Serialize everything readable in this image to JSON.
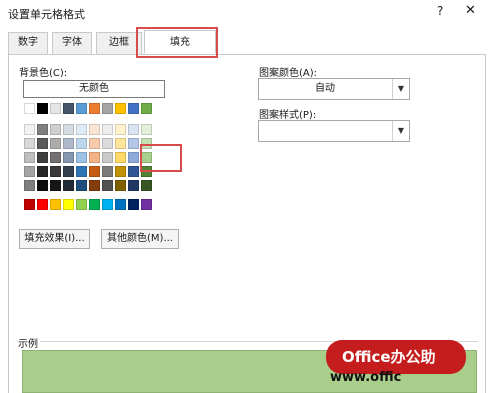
{
  "dialog": {
    "title": "设置单元格格式",
    "help_glyph": "?",
    "close_glyph": "✕"
  },
  "tabs": [
    {
      "label": "数字"
    },
    {
      "label": "字体"
    },
    {
      "label": "边框"
    },
    {
      "label": "填充",
      "active": true
    }
  ],
  "fill": {
    "background_color_label": "背景色(C):",
    "no_color_button": "无颜色",
    "fill_effects_button": "填充效果(I)...",
    "more_colors_button": "其他颜色(M)...",
    "pattern_color_label": "图案颜色(A):",
    "pattern_color_value": "自动",
    "pattern_style_label": "图案样式(P):",
    "pattern_style_value": "",
    "sample_label": "示例",
    "sample_color": "#a9cd8b"
  },
  "palette": {
    "theme_top": [
      "#ffffff",
      "#000000",
      "#e7e6e6",
      "#44546a",
      "#5b9bd5",
      "#ed7d31",
      "#a5a5a5",
      "#ffc000",
      "#4472c4",
      "#70ad47"
    ],
    "tints": [
      [
        "#f2f2f2",
        "#7f7f7f",
        "#d0cece",
        "#d6dce4",
        "#deebf6",
        "#fbe5d5",
        "#ededed",
        "#fff2cc",
        "#dae3f3",
        "#e2efd9"
      ],
      [
        "#d8d8d8",
        "#595959",
        "#aeabab",
        "#adb9ca",
        "#bdd7ee",
        "#f7cbac",
        "#dbdbdb",
        "#fee599",
        "#b4c6e7",
        "#c5e0b3"
      ],
      [
        "#bfbfbf",
        "#3f3f3f",
        "#757070",
        "#8496b0",
        "#9cc3e5",
        "#f4b183",
        "#c9c9c9",
        "#ffd965",
        "#8eaadb",
        "#a8d08d"
      ],
      [
        "#a5a5a5",
        "#262626",
        "#3a3838",
        "#323f4f",
        "#2e75b5",
        "#c55a11",
        "#7b7b7b",
        "#bf9000",
        "#2f5496",
        "#538135"
      ],
      [
        "#7f7f7f",
        "#0c0c0c",
        "#171616",
        "#222a35",
        "#1e4e79",
        "#833c0b",
        "#525252",
        "#7f6000",
        "#1f3864",
        "#375623"
      ]
    ],
    "standard": [
      "#c00000",
      "#ff0000",
      "#ffc000",
      "#ffff00",
      "#92d050",
      "#00b050",
      "#00b0f0",
      "#0070c0",
      "#002060",
      "#7030a0"
    ],
    "highlight_color": "#d64b4b"
  },
  "watermark": {
    "badge_text": "Office办公助",
    "url_text": "www.offic"
  }
}
